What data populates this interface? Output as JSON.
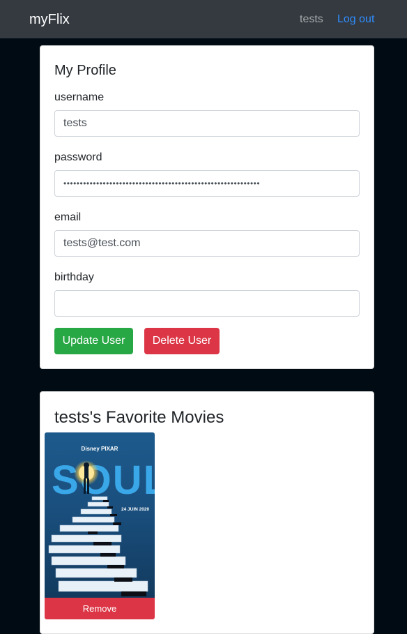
{
  "navbar": {
    "brand": "myFlix",
    "user": "tests",
    "logout": "Log out"
  },
  "profile": {
    "title": "My Profile",
    "fields": {
      "username_label": "username",
      "username_value": "tests",
      "password_label": "password",
      "password_value": "••••••••••••••••••••••••••••••••••••••••••••••••••••••••••••",
      "email_label": "email",
      "email_value": "tests@test.com",
      "birthday_label": "birthday",
      "birthday_value": ""
    },
    "update_button": "Update User",
    "delete_button": "Delete User"
  },
  "favorites": {
    "title": "tests's Favorite Movies",
    "movies": [
      {
        "poster_title": "SOUL",
        "studio": "Disney PIXAR",
        "date": "24 JUIN 2020",
        "remove_label": "Remove"
      }
    ]
  },
  "colors": {
    "background": "#010b13",
    "navbar": "#343a40",
    "success": "#28a745",
    "danger": "#dc3545",
    "link": "#2f8dff"
  }
}
